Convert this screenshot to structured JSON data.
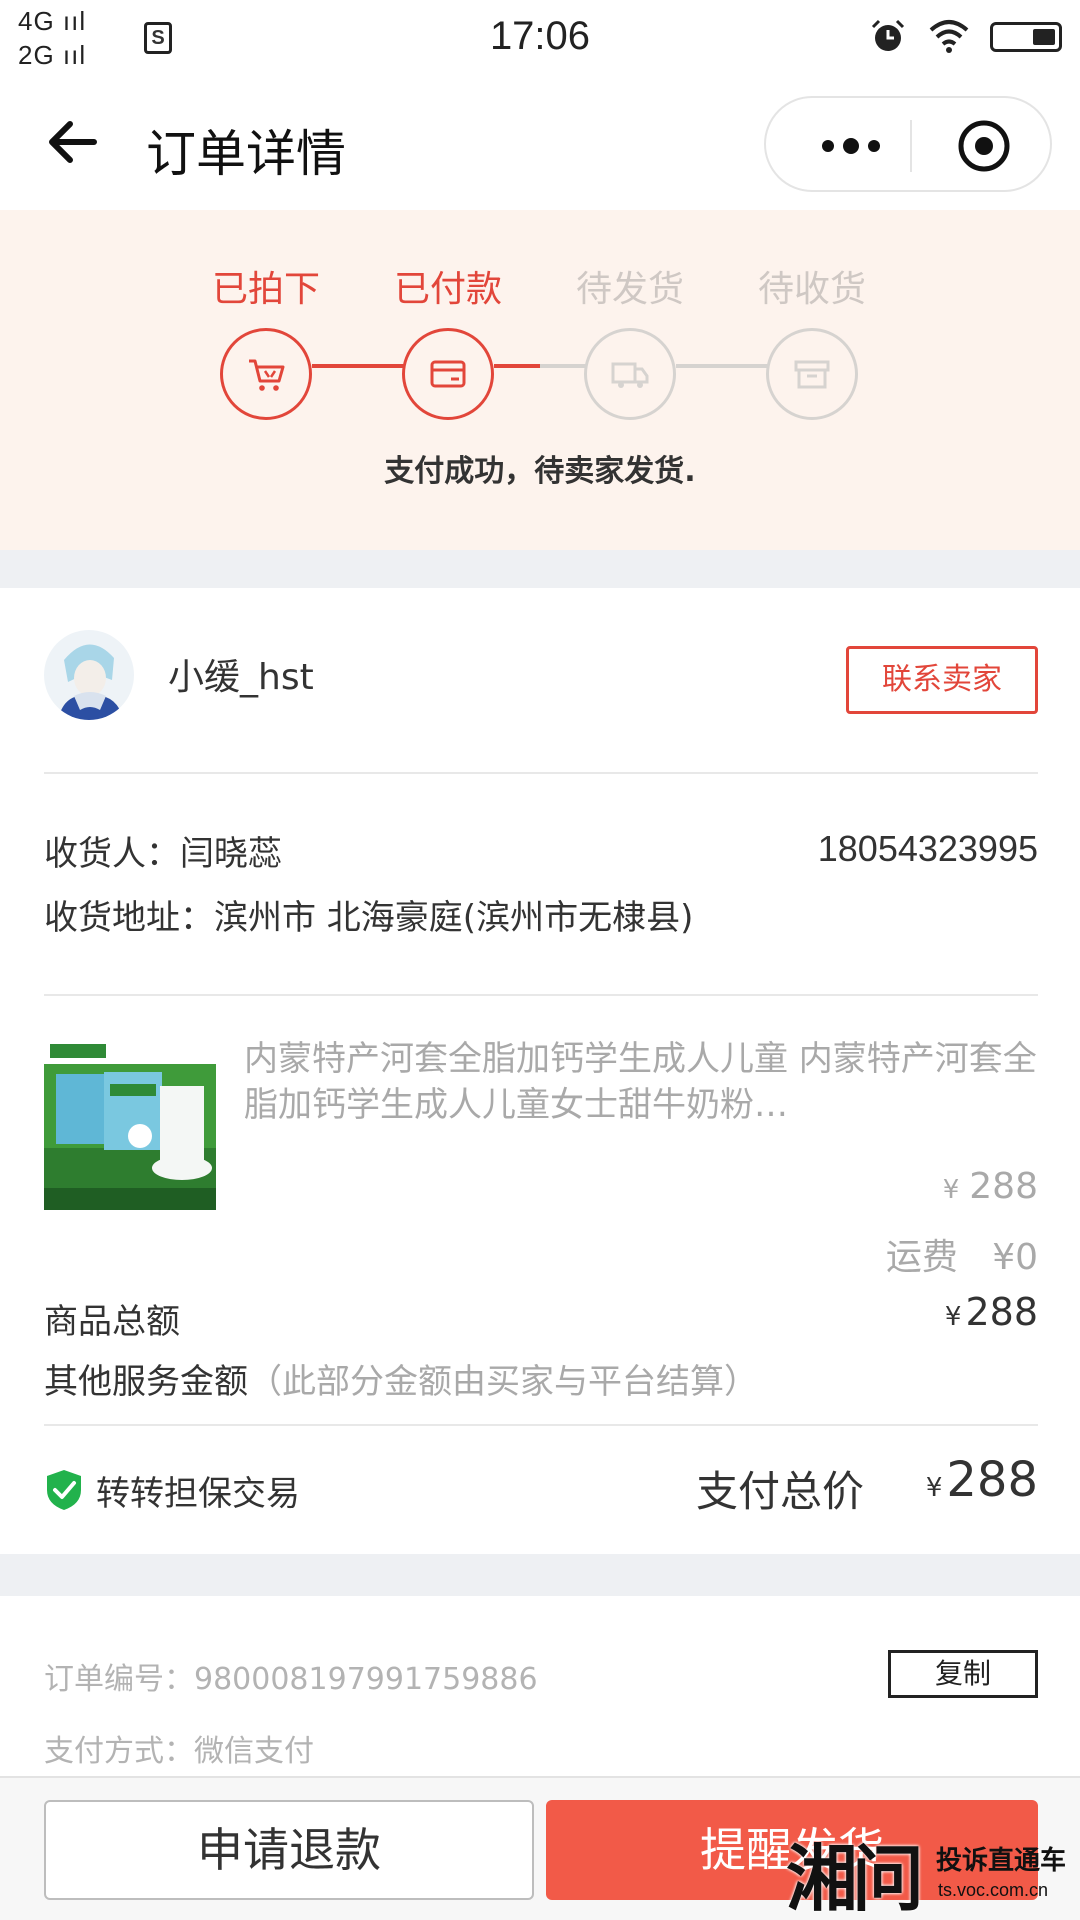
{
  "status_bar": {
    "network_top": "4G",
    "network_bottom": "2G",
    "time": "17:06",
    "sim_icon_text": "S",
    "icons": [
      "signal-icon",
      "sim-icon",
      "alarm-icon",
      "wifi-icon",
      "battery-icon"
    ]
  },
  "nav": {
    "title": "订单详情",
    "icons": [
      "back-arrow-icon",
      "more-dots-icon",
      "target-icon"
    ]
  },
  "progress": {
    "steps": [
      {
        "label": "已拍下",
        "state": "done",
        "icon": "cart-icon"
      },
      {
        "label": "已付款",
        "state": "done",
        "icon": "card-icon"
      },
      {
        "label": "待发货",
        "state": "todo",
        "icon": "truck-icon"
      },
      {
        "label": "待收货",
        "state": "todo",
        "icon": "box-icon"
      }
    ],
    "message": "支付成功，待卖家发货."
  },
  "seller": {
    "name": "小缓_hst",
    "contact_label": "联系卖家"
  },
  "receiver": {
    "name_line": "收货人：闫晓蕊",
    "phone": "18054323995",
    "address_line": "收货地址：滨州市 北海豪庭(滨州市无棣县)"
  },
  "product": {
    "title": "内蒙特产河套全脂加钙学生成人儿童 内蒙特产河套全脂加钙学生成人儿童女士甜牛奶粉…",
    "currency": "¥",
    "price": "288",
    "shipping_label": "运费",
    "shipping_value": "¥0"
  },
  "summary": {
    "goods_total_label": "商品总额",
    "goods_total_currency": "¥",
    "goods_total_value": "288",
    "other_service_label": "其他服务金额",
    "other_service_note": "（此部分金额由买家与平台结算）",
    "guarantee_label": "转转担保交易",
    "total_label": "支付总价",
    "total_currency": "¥",
    "total_value": "288"
  },
  "order": {
    "number_line": "订单编号：980008197991759886",
    "copy_label": "复制",
    "payment_line": "支付方式：微信支付"
  },
  "actions": {
    "refund_label": "申请退款",
    "remind_label": "提醒发货"
  },
  "watermark": {
    "glyph": "湘问",
    "main": "投诉直通车",
    "url": "ts.voc.com.cn"
  },
  "colors": {
    "accent": "#e2463a",
    "remind_button": "#f25a48",
    "progress_bg": "#fdf3ed",
    "guarantee_shield": "#22b24c",
    "muted_text": "#a9a9a9"
  }
}
